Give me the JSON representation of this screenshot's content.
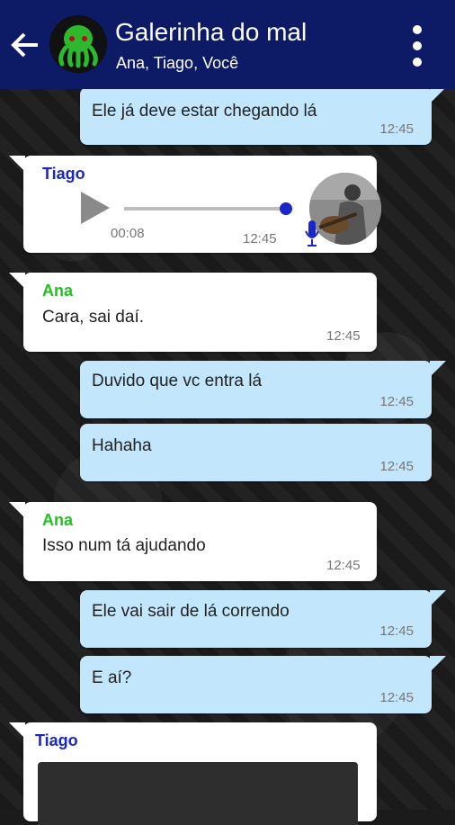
{
  "header": {
    "title": "Galerinha do mal",
    "subtitle": "Ana, Tiago, Você"
  },
  "messages": [
    {
      "type": "out",
      "text": "Ele já deve estar chegando lá",
      "time": "12:45"
    },
    {
      "type": "voice",
      "sender": "Tiago",
      "duration": "00:08",
      "time": "12:45",
      "progress": 1.0
    },
    {
      "type": "in",
      "sender": "Ana",
      "text": "Cara, sai daí.",
      "time": "12:45"
    },
    {
      "type": "out",
      "text": "Duvido que vc entra lá",
      "time": "12:45"
    },
    {
      "type": "out",
      "text": "Hahaha",
      "time": "12:45"
    },
    {
      "type": "in",
      "sender": "Ana",
      "text": "Isso num tá ajudando",
      "time": "12:45"
    },
    {
      "type": "out",
      "text": "Ele vai sair de lá correndo",
      "time": "12:45"
    },
    {
      "type": "out",
      "text": "E aí?",
      "time": "12:45"
    },
    {
      "type": "image",
      "sender": "Tiago"
    }
  ],
  "colors": {
    "appbar": "#0d1a66",
    "outgoing_bubble": "#c2e6fb",
    "incoming_bubble": "#ffffff",
    "tiago_name": "#1a26c8",
    "ana_name": "#1ec31e"
  },
  "icons": {
    "back": "back-arrow-icon",
    "menu": "more-vert-icon",
    "play": "play-icon",
    "mic": "microphone-icon"
  }
}
